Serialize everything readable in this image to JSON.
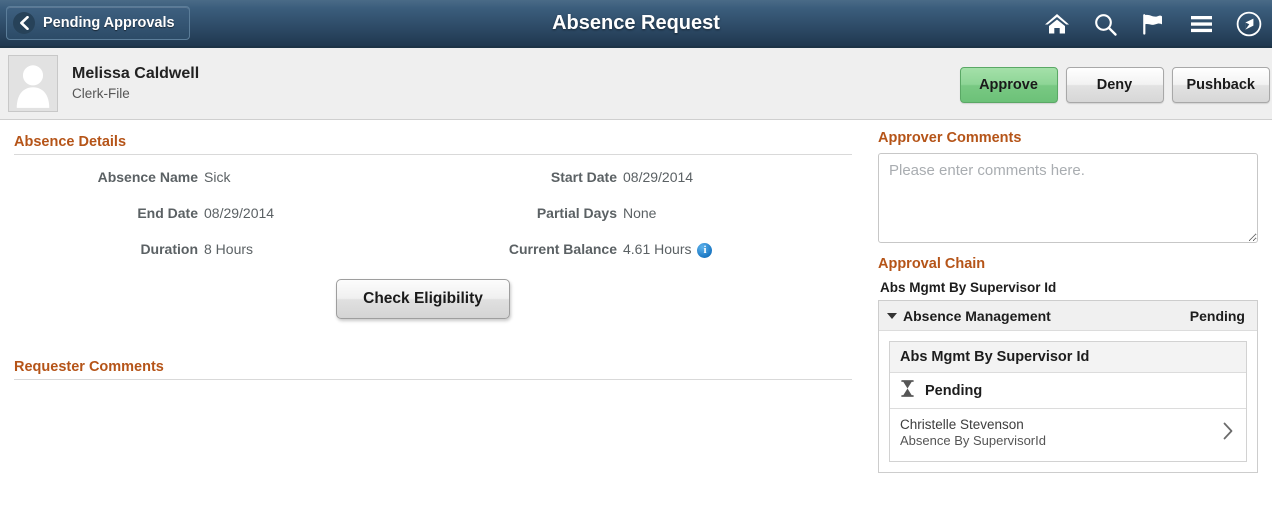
{
  "header": {
    "back_label": "Pending Approvals",
    "title": "Absence Request",
    "icons": [
      {
        "name": "home-icon",
        "label": "Home"
      },
      {
        "name": "search-icon",
        "label": "Search"
      },
      {
        "name": "notifications-flag-icon",
        "label": "Notifications"
      },
      {
        "name": "actions-menu-icon",
        "label": "Actions"
      },
      {
        "name": "navigator-compass-icon",
        "label": "NavBar"
      }
    ],
    "accent_color": "#2d4a66"
  },
  "person": {
    "name": "Melissa Caldwell",
    "role": "Clerk-File",
    "avatar_icon": "user-silhouette-icon"
  },
  "actions": {
    "approve_label": "Approve",
    "deny_label": "Deny",
    "pushback_label": "Pushback",
    "approve_color": "#79c983"
  },
  "absence_details": {
    "heading": "Absence Details",
    "heading_color": "#b55418",
    "left_fields": [
      {
        "label": "Absence Name",
        "value": "Sick"
      },
      {
        "label": "End Date",
        "value": "08/29/2014"
      },
      {
        "label": "Duration",
        "value": "8 Hours"
      }
    ],
    "right_fields": [
      {
        "label": "Start Date",
        "value": "08/29/2014",
        "info": false
      },
      {
        "label": "Partial Days",
        "value": "None",
        "info": false
      },
      {
        "label": "Current Balance",
        "value": "4.61 Hours",
        "info": true
      }
    ],
    "info_icon_char": "i",
    "check_eligibility_label": "Check Eligibility"
  },
  "requester_comments": {
    "heading": "Requester Comments",
    "body": ""
  },
  "approver_comments": {
    "heading": "Approver Comments",
    "placeholder": "Please enter comments here.",
    "value": ""
  },
  "approval_chain": {
    "heading": "Approval Chain",
    "subtitle": "Abs Mgmt By Supervisor Id",
    "group_label": "Absence Management",
    "group_status": "Pending",
    "step": {
      "title": "Abs Mgmt By Supervisor Id",
      "status": "Pending",
      "status_icon": "hourglass-icon",
      "person_name": "Christelle Stevenson",
      "person_role": "Absence By SupervisorId",
      "chevron_icon": "chevron-right-icon"
    }
  }
}
